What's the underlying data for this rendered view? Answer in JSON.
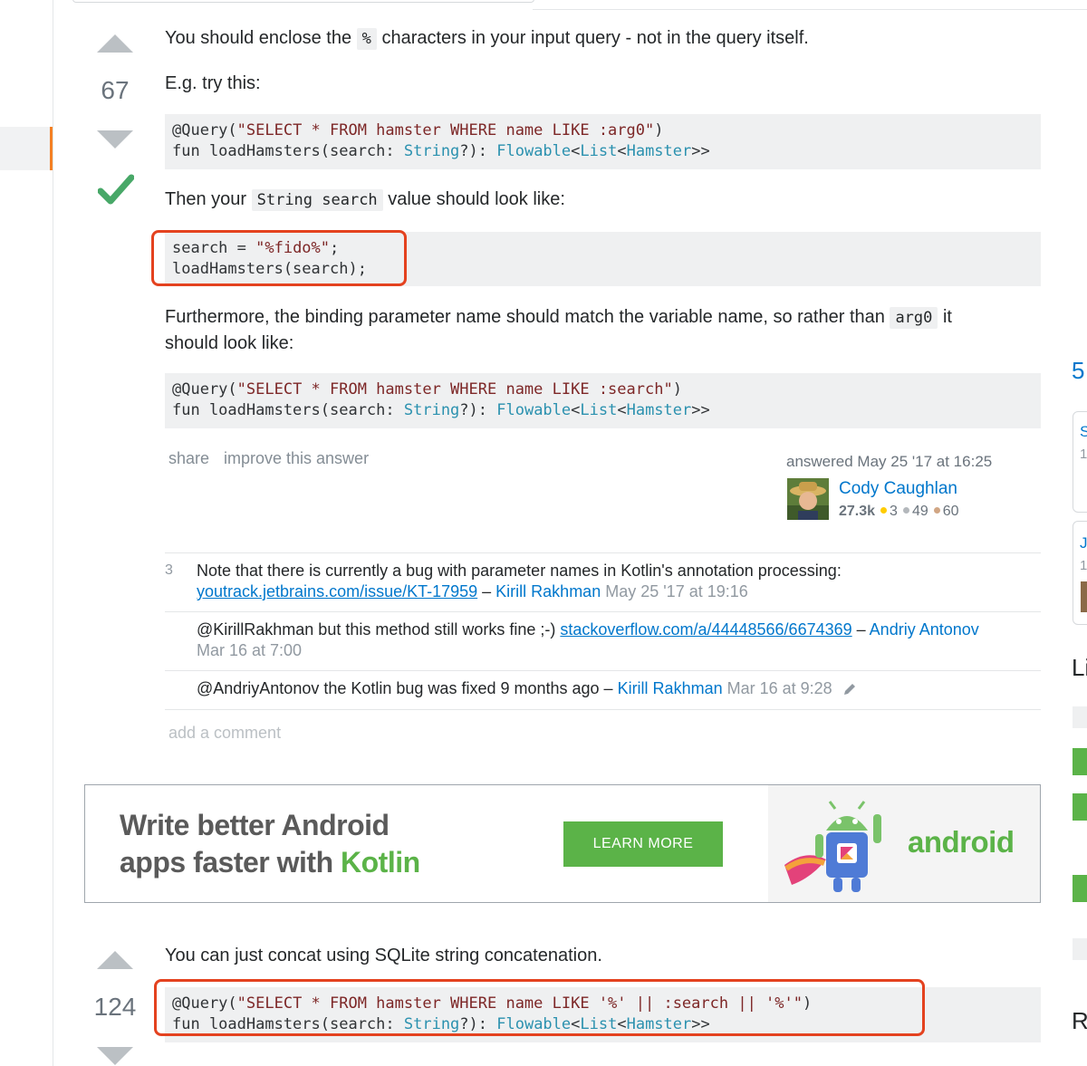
{
  "answer1": {
    "vote_count": "67",
    "intro_pre": "You should enclose the ",
    "intro_code": "%",
    "intro_post": " characters in your input query - not in the query itself.",
    "eg_text": "E.g. try this:",
    "code1": {
      "l1_a": "@Query(",
      "l1_str": "\"SELECT * FROM hamster WHERE name LIKE :arg0\"",
      "l1_b": ")",
      "l2_a": "fun loadHamsters(search: ",
      "l2_t1": "String",
      "l2_b": "?): ",
      "l2_t2": "Flowable",
      "l2_c": "<",
      "l2_t3": "List",
      "l2_d": "<",
      "l2_t4": "Hamster",
      "l2_e": ">>"
    },
    "then_pre": "Then your ",
    "then_code": "String search",
    "then_post": " value should look like:",
    "code2": {
      "l1_a": "search = ",
      "l1_str": "\"%fido%\"",
      "l1_b": ";",
      "l2": "loadHamsters(search);"
    },
    "further_pre": "Furthermore, the binding parameter name should match the variable name, so rather than ",
    "further_code": "arg0",
    "further_post1": " it",
    "further_post2": "should look like:",
    "code3": {
      "l1_a": "@Query(",
      "l1_str": "\"SELECT * FROM hamster WHERE name LIKE :search\"",
      "l1_b": ")",
      "l2_a": "fun loadHamsters(search: ",
      "l2_t1": "String",
      "l2_b": "?): ",
      "l2_t2": "Flowable",
      "l2_c": "<",
      "l2_t3": "List",
      "l2_d": "<",
      "l2_t4": "Hamster",
      "l2_e": ">>"
    },
    "share_label": "share",
    "improve_label": "improve this answer",
    "answered_label": "answered May 25 '17 at 16:25",
    "user_name": "Cody Caughlan",
    "user_rep": "27.3k",
    "gold": "3",
    "silver": "49",
    "bronze": "60",
    "badge_colors": {
      "gold": "#ffcc01",
      "silver": "#b4b8bc",
      "bronze": "#d1a684"
    },
    "comments": [
      {
        "score": "3",
        "text": "Note that there is currently a bug with parameter names in Kotlin's annotation processing:",
        "link": "youtrack.jetbrains.com/issue/KT-17959",
        "dash": " – ",
        "user": "Kirill Rakhman",
        "date": " May 25 '17 at 19:16"
      },
      {
        "text": "@KirillRakhman but this method still works fine ;-) ",
        "link": "stackoverflow.com/a/44448566/6674369",
        "dash": " – ",
        "user": "Andriy Antonov",
        "date": "Mar 16 at 7:00"
      },
      {
        "text": "@AndriyAntonov the Kotlin bug was fixed 9 months ago",
        "dash": " – ",
        "user": "Kirill Rakhman",
        "date": " Mar 16 at 9:28"
      }
    ],
    "add_comment": "add a comment"
  },
  "ad": {
    "line1": "Write better Android",
    "line2_a": "apps faster with ",
    "line2_b": "Kotlin",
    "button": "LEARN MORE",
    "brand": "android",
    "kotlin_color": "#5bb348",
    "brand_color": "#5bb348"
  },
  "answer2": {
    "vote_count": "124",
    "intro": "You can just concat using SQLite string concatenation.",
    "code": {
      "l1_a": "@Query(",
      "l1_str": "\"SELECT * FROM hamster WHERE name LIKE '%' || :search || '%'\"",
      "l1_b": ")",
      "l2_a": "fun loadHamsters(search: ",
      "l2_t1": "String",
      "l2_b": "?): ",
      "l2_t2": "Flowable",
      "l2_c": "<",
      "l2_t3": "List",
      "l2_d": "<",
      "l2_t4": "Hamster",
      "l2_e": ">>"
    }
  },
  "right_col": {
    "n5": "5",
    "s": "S",
    "one_a": "1",
    "j": "J",
    "one_b": "1",
    "li": "Li",
    "r": "R"
  }
}
